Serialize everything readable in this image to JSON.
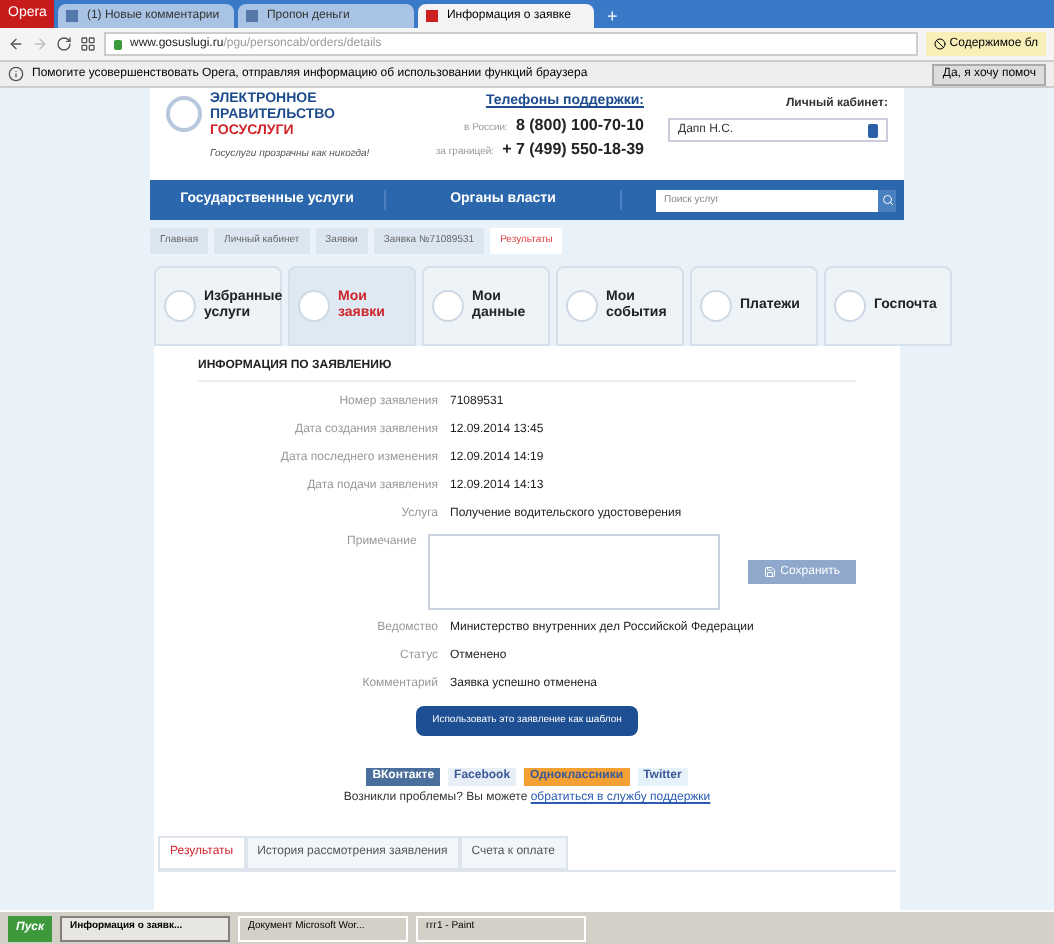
{
  "browser": {
    "menu_label": "Opera",
    "tabs": [
      {
        "label": "(1) Новые комментарии",
        "selected": false
      },
      {
        "label": "Пропон деньги",
        "selected": false
      },
      {
        "label": "Информация о заявке",
        "selected": true
      }
    ],
    "new_tab": "+",
    "url_host": "www.gosuslugi.ru",
    "url_path": "/pgu/personcab/orders/details",
    "content_blocker": "Содержимое бл",
    "infobar_text": "Помогите усовершенствовать Opera, отправляя информацию об использовании функций браузера",
    "infobar_button": "Да, я хочу помоч"
  },
  "header": {
    "logo_lines": [
      "ЭЛЕКТРОННОЕ",
      "ПРАВИТЕЛЬСТВО",
      "ГОСУСЛУГИ"
    ],
    "slogan": "Госуслуги прозрачны как никогда!",
    "support_title": "Телефоны поддержки:",
    "phones": [
      {
        "label": "в России:",
        "number": "8 (800) 100-70-10"
      },
      {
        "label": "за границей:",
        "number": "+ 7 (499) 550-18-39"
      }
    ],
    "cabinet_title": "Личный кабинет:",
    "user": "Дапп Н.С."
  },
  "nav": {
    "items": [
      "Государственные услуги",
      "Органы власти"
    ],
    "search_placeholder": "Поиск услуг"
  },
  "breadcrumbs": [
    {
      "label": "Главная",
      "selected": false
    },
    {
      "label": "Личный кабинет",
      "selected": false
    },
    {
      "label": "Заявки",
      "selected": false
    },
    {
      "label": "Заявка №71089531",
      "selected": false
    },
    {
      "label": "Результаты",
      "selected": true
    }
  ],
  "tiles": [
    {
      "label": "Избранные услуги",
      "selected": false
    },
    {
      "label": "Мои заявки",
      "selected": true
    },
    {
      "label": "Мои данные",
      "selected": false
    },
    {
      "label": "Мои события",
      "selected": false
    },
    {
      "label": "Платежи",
      "selected": false
    },
    {
      "label": "Госпочта",
      "selected": false
    }
  ],
  "info": {
    "title": "ИНФОРМАЦИЯ ПО ЗАЯВЛЕНИЮ",
    "fields": [
      {
        "label": "Номер заявления",
        "value": "71089531"
      },
      {
        "label": "Дата создания заявления",
        "value": "12.09.2014 13:45"
      },
      {
        "label": "Дата последнего изменения",
        "value": "12.09.2014 14:19"
      },
      {
        "label": "Дата подачи заявления",
        "value": "12.09.2014 14:13"
      },
      {
        "label": "Услуга",
        "value": "Получение водительского удостоверения"
      }
    ],
    "note_label": "Примечание",
    "save_button": "Сохранить",
    "fields_after": [
      {
        "label": "Ведомство",
        "value": "Министерство внутренних дел Российской Федерации"
      },
      {
        "label": "Статус",
        "value": "Отменено"
      },
      {
        "label": "Комментарий",
        "value": "Заявка успешно отменена"
      }
    ],
    "template_button": "Использовать это заявление как шаблон"
  },
  "share": [
    {
      "label": "ВКонтакте",
      "color": "#4a6f9c"
    },
    {
      "label": "Facebook",
      "color": "#e8eef6"
    },
    {
      "label": "Одноклассники",
      "color": "#f4a032"
    },
    {
      "label": "Twitter",
      "color": "#e6f2fa"
    }
  ],
  "problem": {
    "text": "Возникли проблемы? Вы можете",
    "link": "обратиться в службу поддержки"
  },
  "bottom_tabs": [
    {
      "label": "Результаты",
      "selected": true
    },
    {
      "label": "История рассмотрения заявления",
      "selected": false
    },
    {
      "label": "Счета к оплате",
      "selected": false
    }
  ],
  "taskbar": {
    "start": "Пуск",
    "items": [
      {
        "label": "Информация о заявк...",
        "selected": true
      },
      {
        "label": "Документ Microsoft Wor...",
        "selected": false
      },
      {
        "label": "ггг1 - Paint",
        "selected": false
      }
    ]
  }
}
